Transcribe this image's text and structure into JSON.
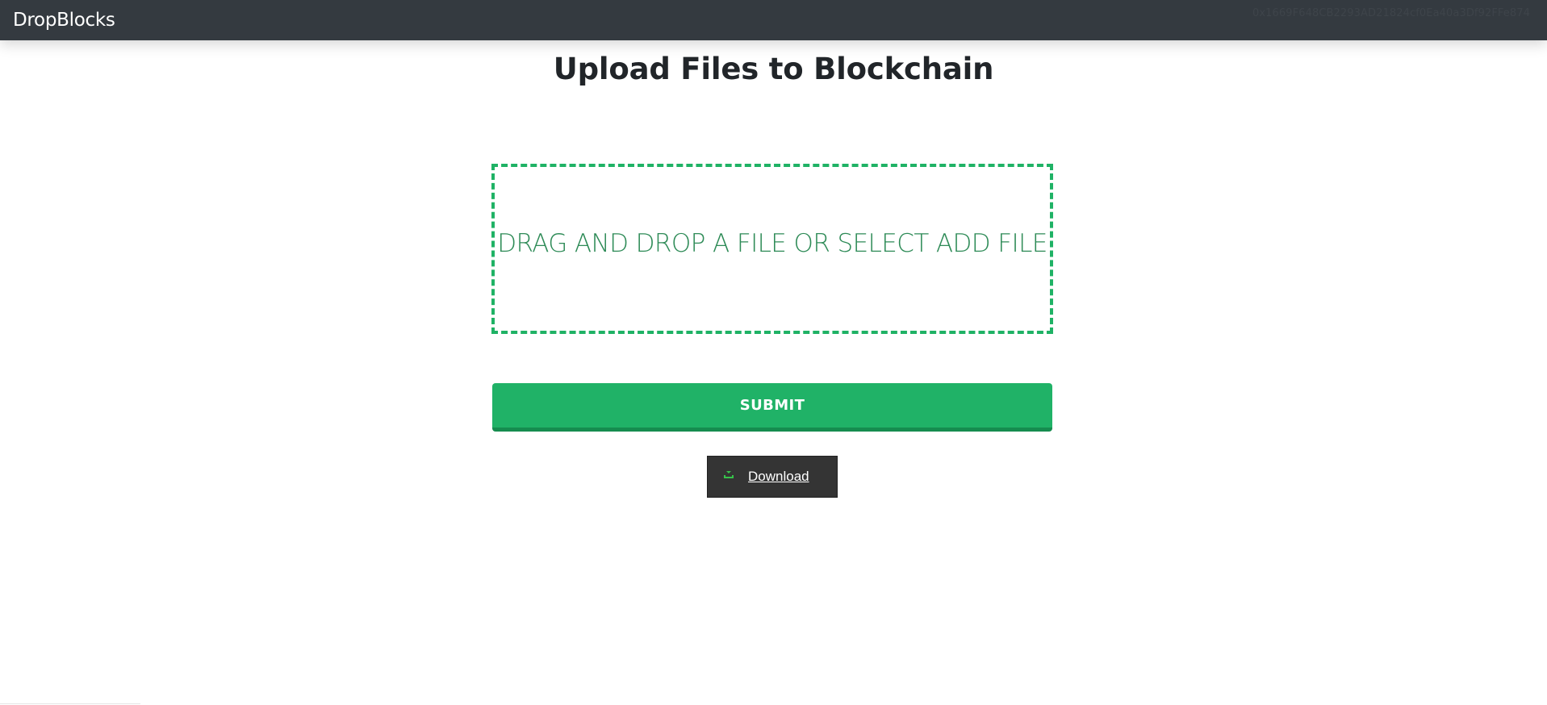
{
  "navbar": {
    "brand": "DropBlocks",
    "wallet_address": "0x1669F648CB2293AD21824cf0Ea40a3Df92FFe874"
  },
  "main": {
    "title": "Upload Files to Blockchain",
    "dropzone_text": "DRAG AND DROP A FILE OR SELECT ADD FILE",
    "submit_label": "SUBMIT",
    "download_label": "Download",
    "download_icon": "download-arrow-icon"
  },
  "colors": {
    "navbar_bg": "#343a40",
    "accent_green": "#20b267",
    "dropzone_text": "#2e8b57",
    "download_bg": "#343434",
    "download_icon": "#37c24a"
  }
}
